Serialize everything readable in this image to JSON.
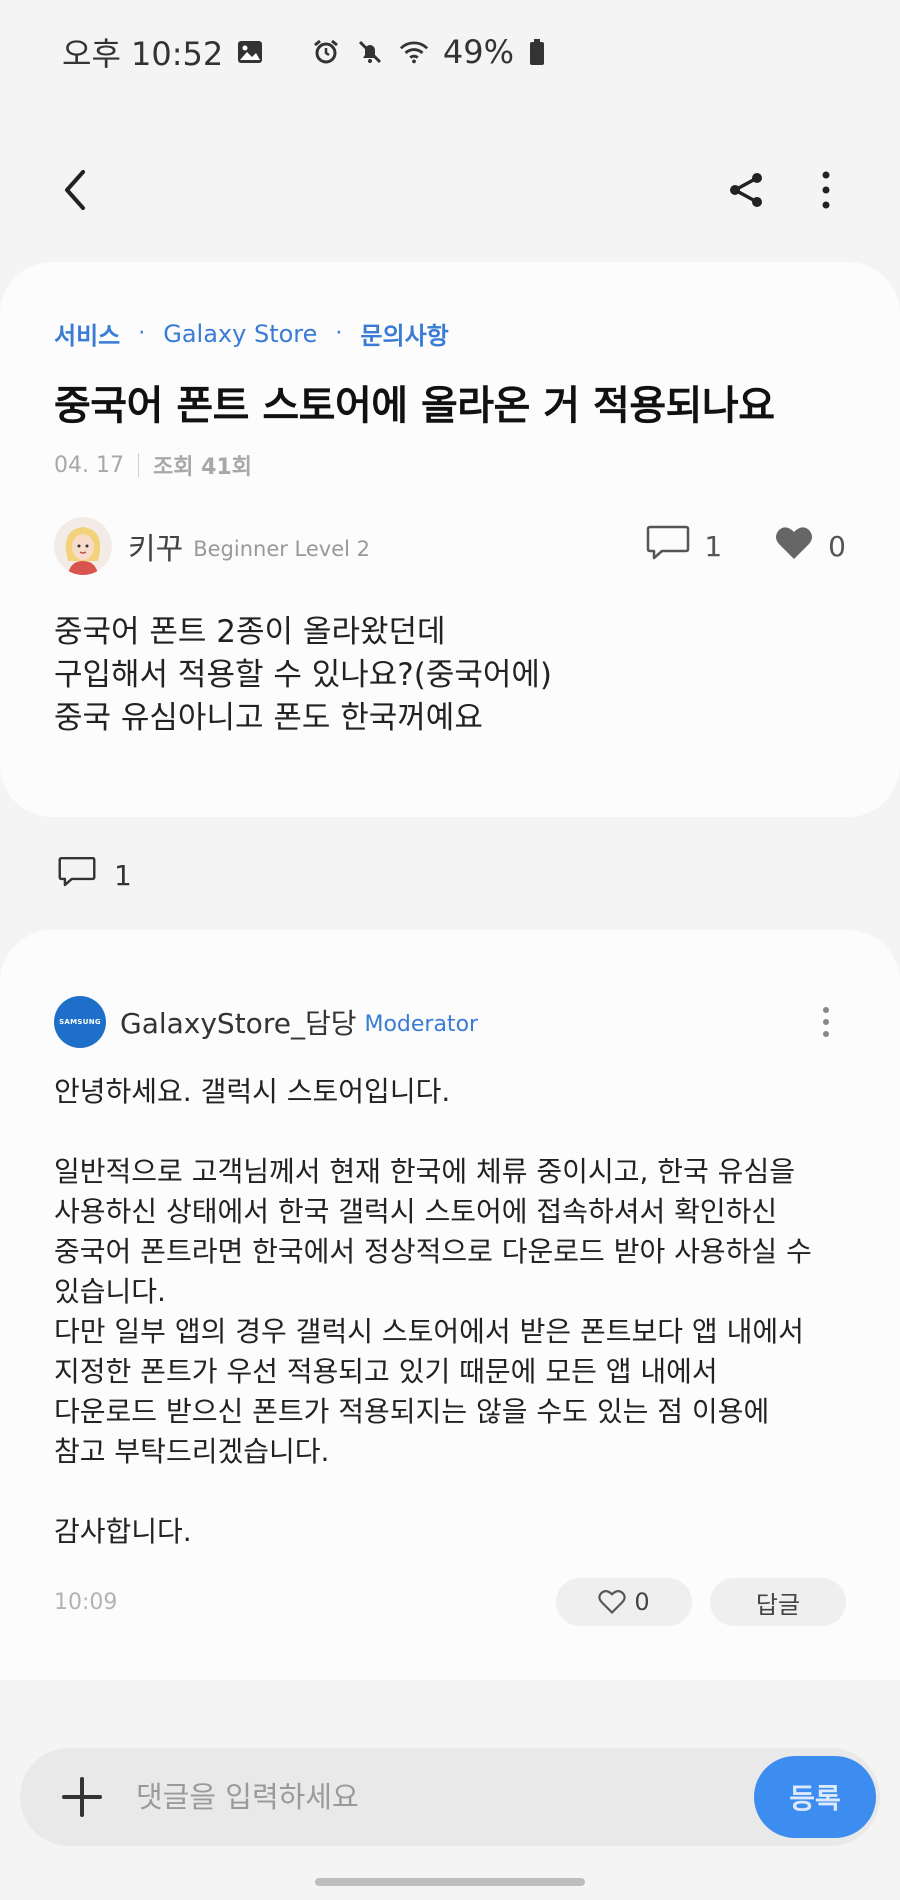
{
  "status_bar": {
    "time": "오후 10:52",
    "battery": "49%",
    "icons": [
      "gallery-icon",
      "alarm-icon",
      "mute-icon",
      "wifi-icon",
      "battery-icon"
    ]
  },
  "top_bar": {
    "icons": [
      "back-icon",
      "share-icon",
      "more-vertical-icon"
    ]
  },
  "post": {
    "breadcrumb": {
      "category": "서비스",
      "separator1": "·",
      "store": "Galaxy Store",
      "separator2": "·",
      "board": "문의사항"
    },
    "title": "중국어 폰트 스토어에 올라온 거 적용되나요",
    "date": "04. 17",
    "views": "조회 41회",
    "author": {
      "name": "키꾸",
      "level": "Beginner Level 2"
    },
    "comment_count": "1",
    "like_count": "0",
    "body_lines": [
      "중국어 폰트 2종이 올라왔던데",
      "구입해서 적용할 수 있나요?(중국어에)",
      "중국 유심아니고 폰도 한국꺼예요"
    ]
  },
  "comments_header": {
    "count": "1"
  },
  "comment": {
    "avatar_text": "SAMSUNG",
    "author": "GalaxyStore_담당",
    "role": "Moderator",
    "body": {
      "greeting": "안녕하세요. 갤럭시 스토어입니다.",
      "p1": [
        "일반적으로 고객님께서 현재 한국에 체류 중이시고, 한국 유심을",
        "사용하신 상태에서 한국 갤럭시 스토어에 접속하셔서 확인하신",
        "중국어 폰트라면 한국에서 정상적으로 다운로드 받아 사용하실 수",
        "있습니다.",
        "다만 일부 앱의 경우 갤럭시 스토어에서 받은 폰트보다 앱 내에서",
        "지정한 폰트가 우선 적용되고 있기 때문에 모든 앱 내에서",
        "다운로드 받으신 폰트가 적용되지는 않을 수도 있는 점 이용에",
        "참고 부탁드리겠습니다."
      ],
      "closing": "감사합니다."
    },
    "time": "10:09",
    "like_count": "0",
    "reply_label": "답글"
  },
  "input_bar": {
    "placeholder": "댓글을 입력하세요",
    "submit_label": "등록"
  },
  "colors": {
    "accent": "#3a7bd5",
    "submit": "#3d8cf0",
    "background": "#f4f4f4",
    "card": "#fcfcfc"
  }
}
